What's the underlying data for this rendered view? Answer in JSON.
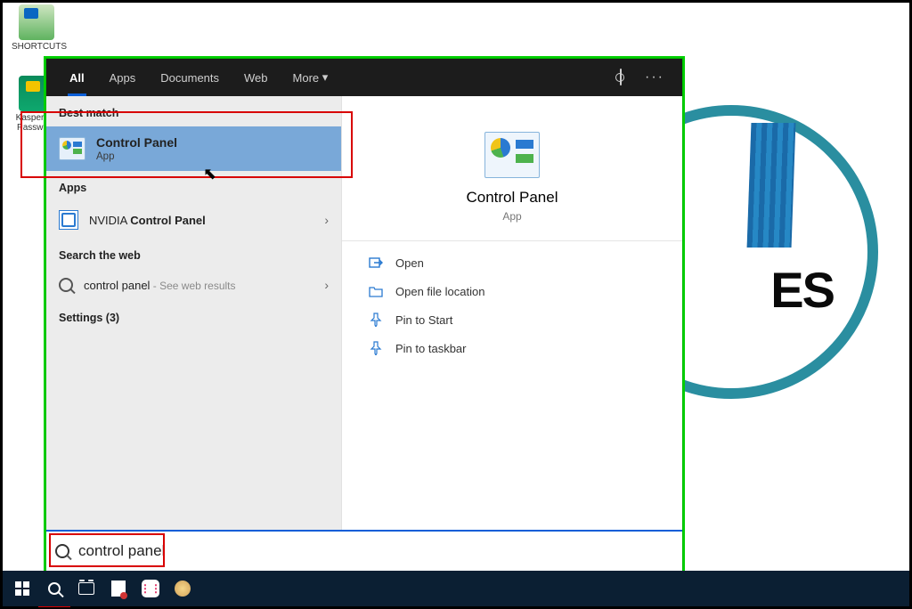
{
  "desktop": {
    "icons": [
      {
        "label": "SHORTCUTS"
      },
      {
        "label": "Kaspersky Password"
      }
    ],
    "wallpaper_text_fragment": "ES"
  },
  "search": {
    "tabs": {
      "all": "All",
      "apps": "Apps",
      "documents": "Documents",
      "web": "Web",
      "more": "More"
    },
    "sections": {
      "best_match": "Best match",
      "apps": "Apps",
      "web": "Search the web",
      "settings": "Settings (3)"
    },
    "best": {
      "title": "Control Panel",
      "subtitle": "App"
    },
    "app_result": {
      "prefix": "NVIDIA ",
      "bold": "Control Panel"
    },
    "web_result": {
      "query": "control panel",
      "hint": " - See web results"
    },
    "preview": {
      "title": "Control Panel",
      "subtitle": "App",
      "actions": {
        "open": "Open",
        "open_loc": "Open file location",
        "pin_start": "Pin to Start",
        "pin_taskbar": "Pin to taskbar"
      }
    },
    "input_value": "control panel"
  }
}
